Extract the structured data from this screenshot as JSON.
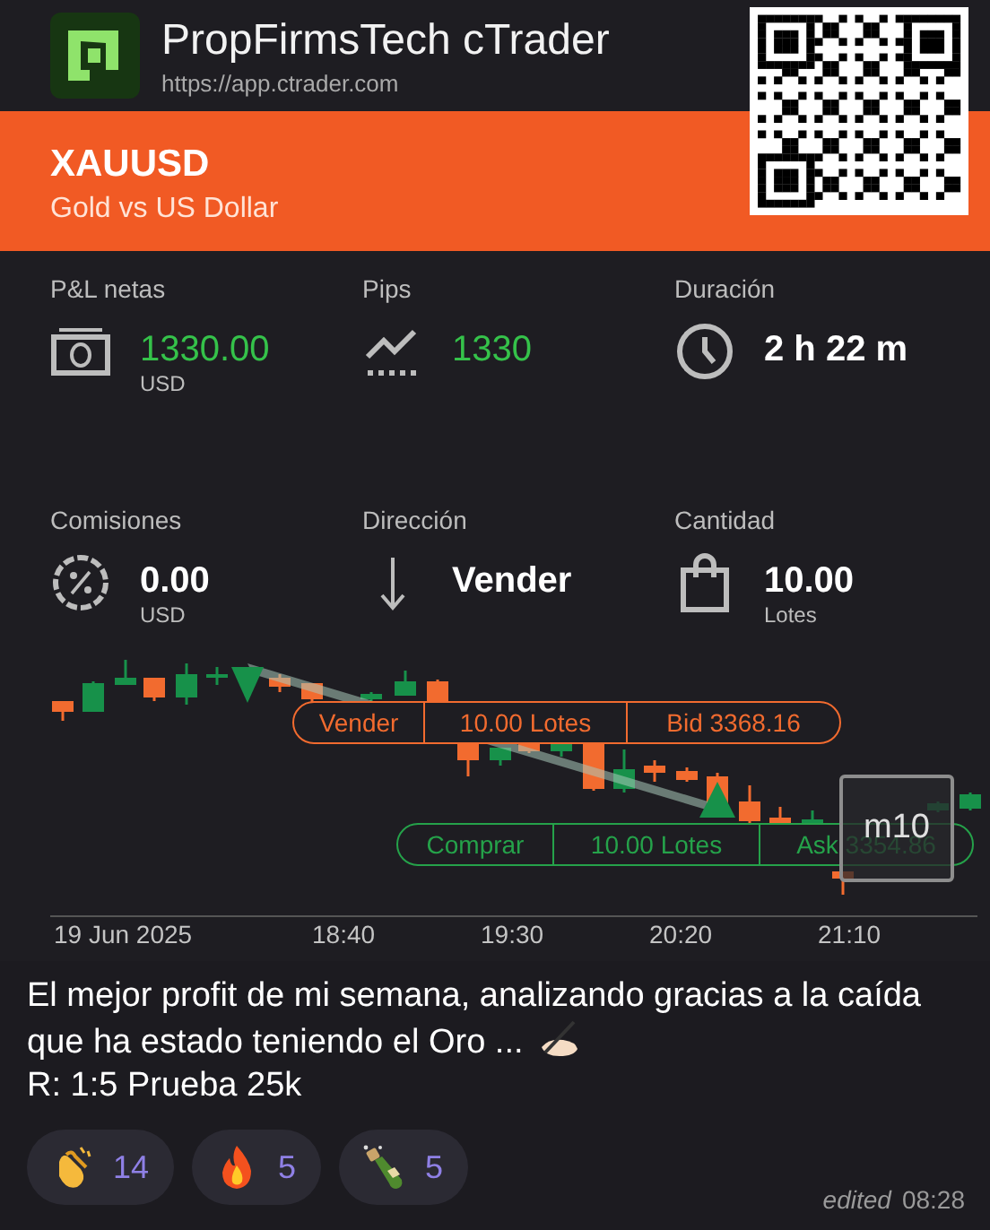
{
  "app": {
    "name": "PropFirmsTech cTrader",
    "url": "https://app.ctrader.com"
  },
  "symbol": {
    "code": "XAUUSD",
    "description": "Gold vs US Dollar"
  },
  "stats": [
    {
      "label": "P&L netas",
      "value": "1330.00",
      "unit": "USD",
      "kind": "money",
      "positive": true
    },
    {
      "label": "Pips",
      "value": "1330",
      "kind": "pips",
      "positive": true
    },
    {
      "label": "Duración",
      "value": "2 h 22 m",
      "kind": "clock",
      "positive": false
    },
    {
      "label": "Comisiones",
      "value": "0.00",
      "unit": "USD",
      "kind": "percent",
      "positive": false
    },
    {
      "label": "Dirección",
      "value": "Vender",
      "kind": "down",
      "positive": false
    },
    {
      "label": "Cantidad",
      "value": "10.00",
      "unit": "Lotes",
      "kind": "bag",
      "positive": false
    }
  ],
  "chart": {
    "orders": [
      {
        "kind": "sell",
        "action": "Vender",
        "quantity": "10.00 Lotes",
        "price": "Bid 3368.16"
      },
      {
        "kind": "buy",
        "action": "Comprar",
        "quantity": "10.00 Lotes",
        "price": "Ask 3354.86"
      }
    ],
    "timeframe": "m10",
    "x_labels": [
      "19 Jun 2025",
      "18:40",
      "19:30",
      "20:20",
      "21:10"
    ]
  },
  "message": {
    "text": "El mejor profit de mi semana, analizando gracias a la caída que ha estado teniendo el Oro ...",
    "line_2": "R: 1:5 Prueba 25k",
    "reactions": [
      {
        "kind": "clap",
        "count": "14"
      },
      {
        "kind": "fire",
        "count": "5"
      },
      {
        "kind": "bottle",
        "count": "5"
      }
    ],
    "edited": "edited",
    "time": "08:28"
  }
}
